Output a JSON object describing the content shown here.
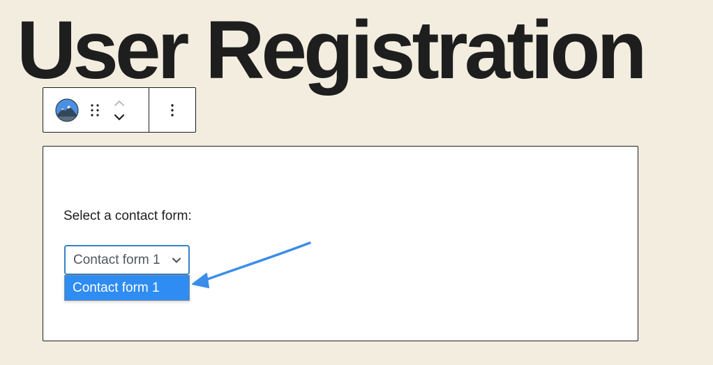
{
  "page": {
    "title": "User Registration"
  },
  "toolbar": {
    "block_icon": "contact-form-block-icon",
    "drag_icon": "drag-handle-icon",
    "move_up_icon": "chevron-up-icon",
    "move_down_icon": "chevron-down-icon",
    "options_icon": "more-vertical-icon"
  },
  "form_block": {
    "label": "Select a contact form:",
    "select": {
      "selected_value": "Contact form 1",
      "options": [
        "Contact form 1"
      ],
      "highlighted_option": "Contact form 1"
    }
  },
  "colors": {
    "background": "#f3ede0",
    "title": "#1e1e1e",
    "select_border": "#3582c4",
    "option_highlight": "#2f8cf2",
    "annotation_arrow": "#3b8de8",
    "block_icon_blue": "#4a90e2"
  }
}
